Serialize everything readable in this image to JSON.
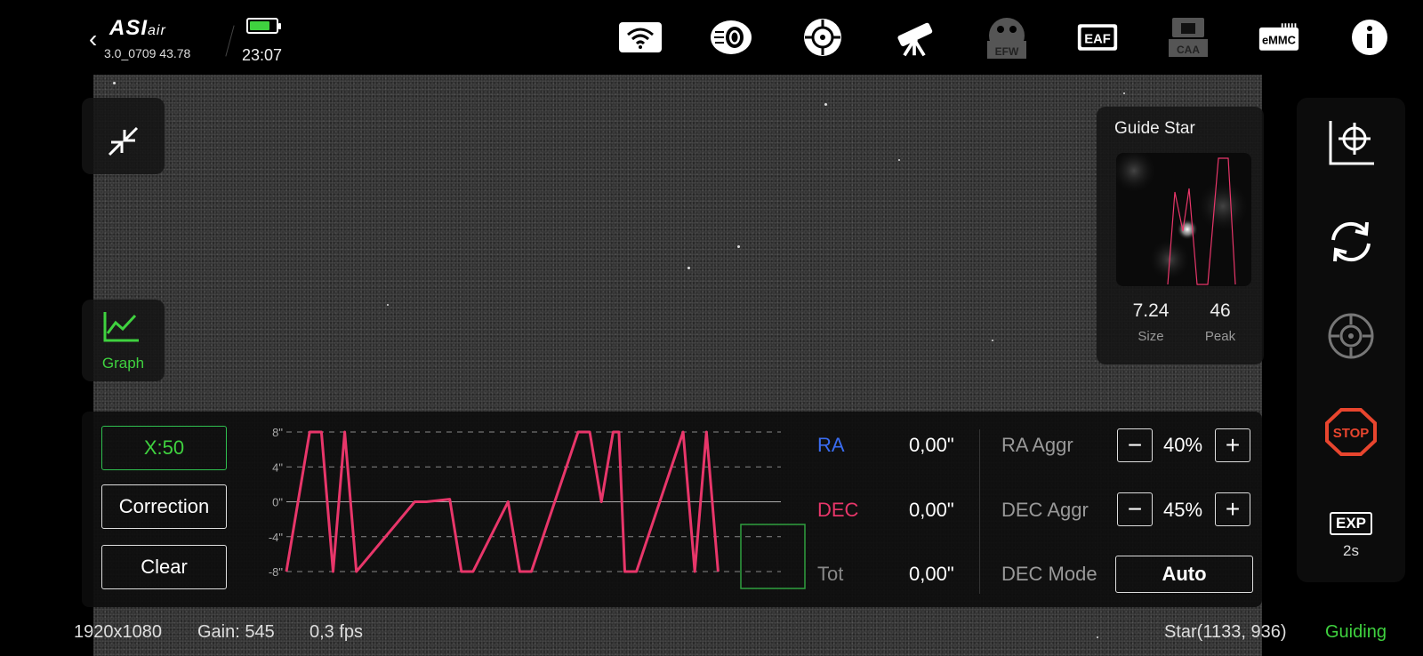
{
  "header": {
    "brand": "ASI",
    "brand_suffix": "air",
    "version": "3.0_0709 43.78",
    "time": "23:07",
    "icons": [
      "wifi-icon",
      "storage-icon",
      "guide-scope-icon",
      "telescope-icon",
      "efw-icon",
      "eaf-icon",
      "caa-icon",
      "emmc-icon",
      "info-icon"
    ],
    "efw_label": "EFW",
    "eaf_label": "EAF",
    "caa_label": "CAA",
    "emmc_label": "eMMC"
  },
  "left_tools": {
    "graph_label": "Graph"
  },
  "guide_star": {
    "title": "Guide Star",
    "size_value": "7.24",
    "size_label": "Size",
    "peak_value": "46",
    "peak_label": "Peak"
  },
  "right_bar": {
    "exp_label": "EXP",
    "exp_value": "2s",
    "stop_label": "STOP"
  },
  "controls": {
    "x_scale": "X:50",
    "correction": "Correction",
    "clear": "Clear"
  },
  "chart_data": {
    "type": "line",
    "y_ticks": [
      "8\"",
      "4\"",
      "0\"",
      "-4\"",
      "-8\""
    ],
    "ylim": [
      -8,
      8
    ],
    "series": [
      {
        "color": "#e8366a",
        "x": [
          0,
          2,
          3,
          4,
          5,
          6,
          11,
          12,
          14,
          15,
          16,
          19,
          20,
          21,
          25,
          26,
          27,
          28,
          28.5,
          29,
          30,
          34,
          35,
          36,
          37
        ],
        "values": [
          -8,
          8,
          8,
          -8,
          8,
          -8,
          0,
          0,
          0.3,
          -8,
          -8,
          0,
          -8,
          -8,
          8,
          8,
          0,
          8,
          8,
          -8,
          -8,
          8,
          -8,
          8,
          -8
        ]
      }
    ]
  },
  "readouts": {
    "ra_label": "RA",
    "ra_value": "0,00\"",
    "dec_label": "DEC",
    "dec_value": "0,00\"",
    "tot_label": "Tot",
    "tot_value": "0,00\""
  },
  "aggressiveness": {
    "ra_label": "RA Aggr",
    "ra_value": "40%",
    "dec_label": "DEC Aggr",
    "dec_value": "45%",
    "mode_label": "DEC Mode",
    "mode_value": "Auto",
    "minus": "−",
    "plus": "+"
  },
  "status_bar": {
    "resolution": "1920x1080",
    "gain": "Gain: 545",
    "fps": "0,3 fps",
    "star_pos": "Star(1133, 936)",
    "state": "Guiding"
  },
  "colors": {
    "accent_green": "#3fd23f",
    "ra_blue": "#3a6cf0",
    "dec_red": "#e8366a",
    "stop_red": "#e8452e"
  }
}
